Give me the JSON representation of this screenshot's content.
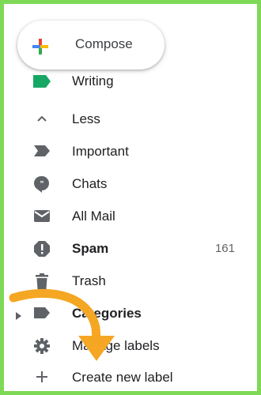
{
  "compose": {
    "label": "Compose"
  },
  "labels": {
    "writing": "Writing",
    "less": "Less",
    "important": "Important",
    "chats": "Chats",
    "all_mail": "All Mail",
    "spam": "Spam",
    "spam_count": "161",
    "trash": "Trash",
    "categories": "Categories",
    "manage_labels": "Manage labels",
    "create_new_label": "Create new label"
  },
  "colors": {
    "frame_border": "#7ed957",
    "annotation_arrow": "#f5a623",
    "label_tag_green": "#16a765",
    "icon_gray": "#5f6368"
  }
}
